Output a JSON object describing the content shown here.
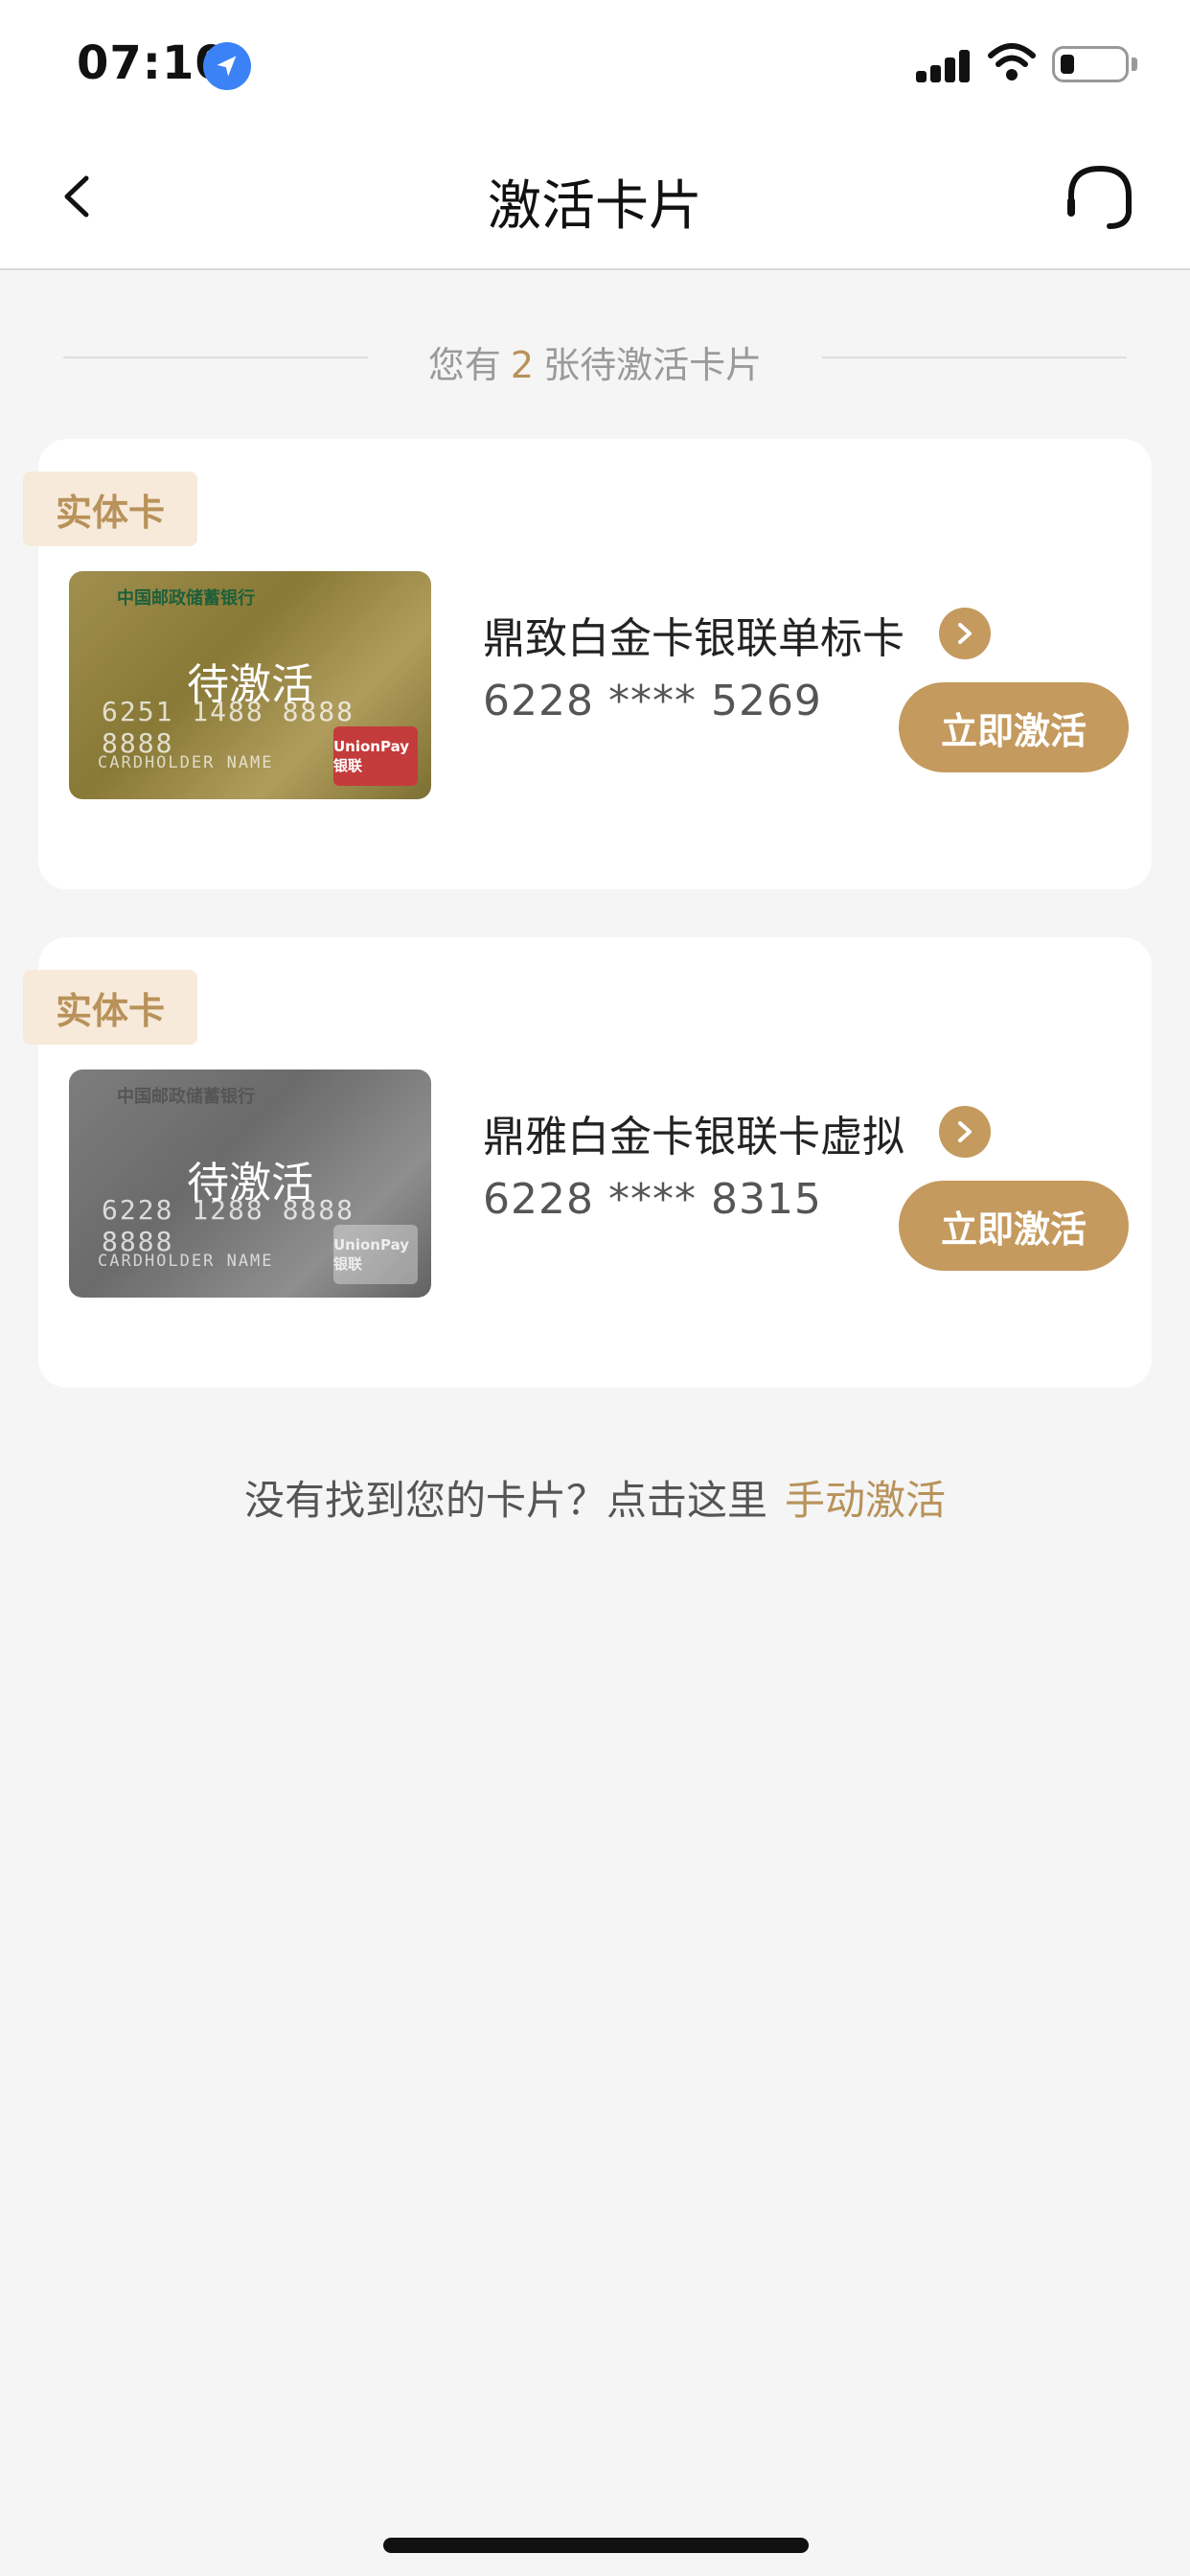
{
  "status_bar": {
    "time": "07:10"
  },
  "header": {
    "title": "激活卡片"
  },
  "summary": {
    "prefix": "您有",
    "count": "2",
    "suffix": "张待激活卡片"
  },
  "cards": [
    {
      "tag": "实体卡",
      "status": "待激活",
      "name": "鼎致白金卡银联单标卡",
      "number": "6228 **** 5269",
      "action": "立即激活",
      "card_face": {
        "bank": "中国邮政储蓄银行",
        "number": "6251 1488 8888 8888",
        "holder": "CARDHOLDER NAME",
        "logo": "UnionPay 银联"
      }
    },
    {
      "tag": "实体卡",
      "status": "待激活",
      "name": "鼎雅白金卡银联卡虚拟",
      "number": "6228 **** 8315",
      "action": "立即激活",
      "card_face": {
        "bank": "中国邮政储蓄银行",
        "number": "6228 1288 8888 8888",
        "holder": "CARDHOLDER NAME",
        "logo": "UnionPay 银联"
      }
    }
  ],
  "footer": {
    "text": "没有找到您的卡片？点击这里",
    "link": "手动激活"
  },
  "colors": {
    "accent": "#c49a5e",
    "accent_text": "#b8925a",
    "tag_bg": "#f7eada",
    "background": "#f5f5f5"
  },
  "icons": {
    "back": "chevron-left-icon",
    "service": "headset-icon",
    "arrow": "chevron-right-icon",
    "location": "location-arrow-icon"
  }
}
